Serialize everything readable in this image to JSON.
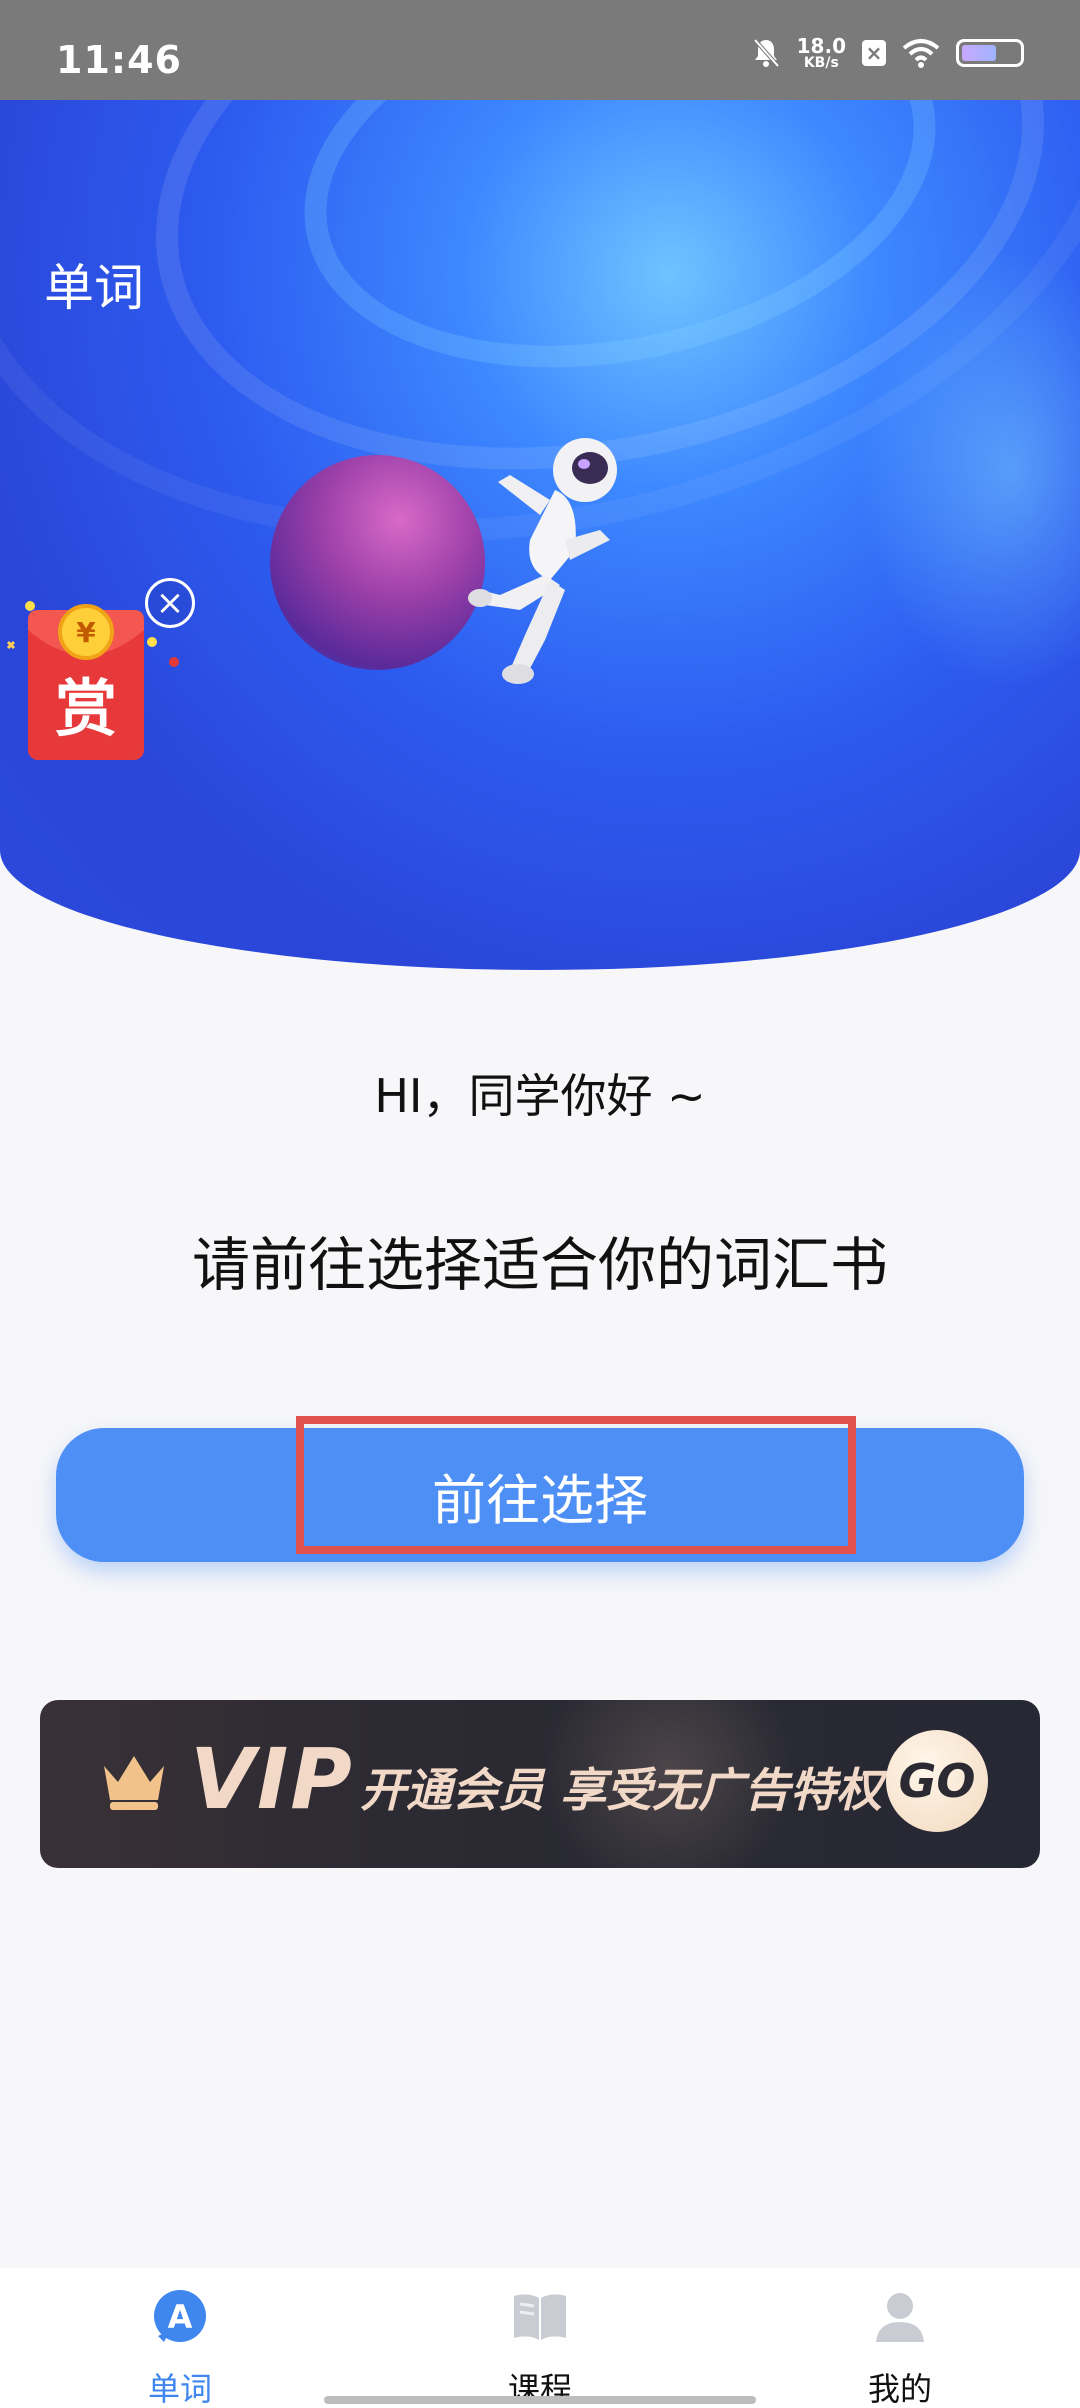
{
  "status_bar": {
    "time": "11:46",
    "network_speed_value": "18.0",
    "network_speed_unit": "KB/s",
    "icons": [
      "bell-off-icon",
      "close-badge-icon",
      "wifi-icon",
      "battery-icon"
    ]
  },
  "hero": {
    "title": "单词",
    "red_packet_label": "赏",
    "red_packet_coin": "¥"
  },
  "main": {
    "greeting": "HI，同学你好 ~",
    "prompt": "请前往选择适合你的词汇书",
    "choose_button_label": "前往选择"
  },
  "vip_banner": {
    "vip_word": "VIP",
    "text": "开通会员 享受无广告特权",
    "go_label": "GO"
  },
  "bottom_nav": {
    "items": [
      {
        "label": "单词",
        "icon": "words-icon",
        "active": true
      },
      {
        "label": "课程",
        "icon": "book-icon",
        "active": false
      },
      {
        "label": "我的",
        "icon": "profile-icon",
        "active": false
      }
    ]
  },
  "colors": {
    "accent": "#4d8ff5",
    "active_tab": "#3f86ef",
    "highlight_box": "#e0524e",
    "hero_blue": "#2d5cf0"
  }
}
